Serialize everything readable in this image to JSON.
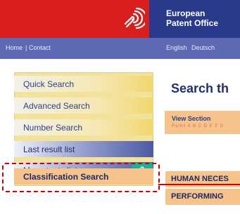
{
  "header": {
    "org_line1": "European",
    "org_line2": "Patent Office",
    "logo": "epo-logo-icon"
  },
  "nav": {
    "home": "Home",
    "separator": "|",
    "contact": "Contact",
    "english": "English",
    "deutsch": "Deutsch"
  },
  "sidebar": {
    "items": [
      {
        "label": "Quick Search"
      },
      {
        "label": "Advanced Search"
      },
      {
        "label": "Number Search"
      },
      {
        "label": "Last result list"
      },
      {
        "label": "My patents list",
        "count": "0"
      },
      {
        "label": "Classification Search",
        "active": true
      }
    ]
  },
  "main": {
    "title": "Search th",
    "view_section": {
      "label": "View Section",
      "letters": "Paths A B C D E F G"
    },
    "sections": [
      "HUMAN NECES",
      "PERFORMING"
    ]
  },
  "colors": {
    "brand_red": "#d81e1e",
    "brand_blue": "#2a3a8a",
    "nav_blue": "#5d6ab3",
    "highlight": "#d10000",
    "badge": "#19b09c"
  }
}
